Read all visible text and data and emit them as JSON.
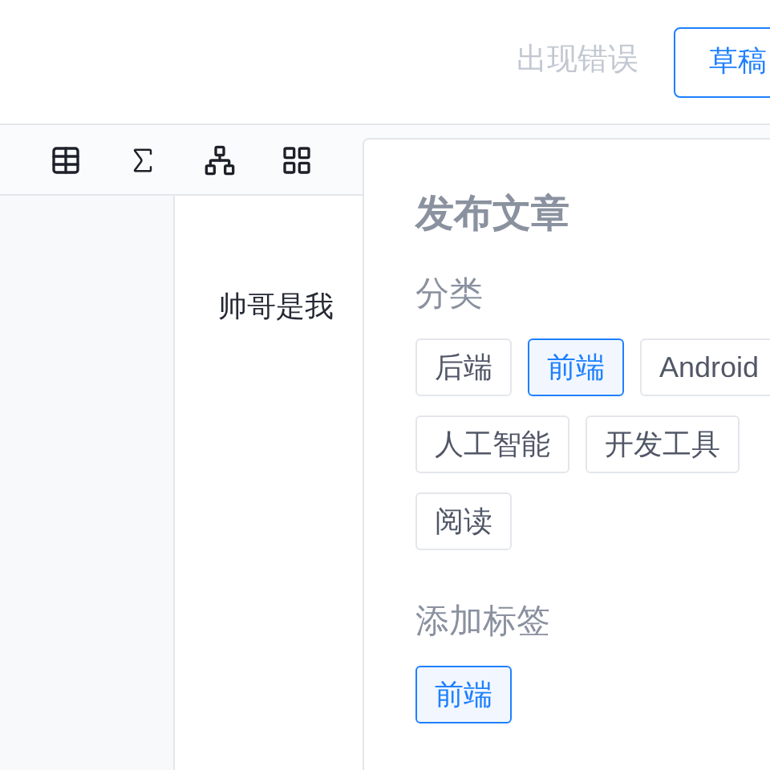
{
  "header": {
    "status": "出现错误",
    "draft_button": "草稿"
  },
  "editor": {
    "text": "帅哥是我"
  },
  "publish_panel": {
    "title": "发布文章",
    "category_label": "分类",
    "category_rows": [
      [
        {
          "label": "后端",
          "selected": false
        },
        {
          "label": "前端",
          "selected": true
        },
        {
          "label": "Android",
          "selected": false
        }
      ],
      [
        {
          "label": "人工智能",
          "selected": false
        },
        {
          "label": "开发工具",
          "selected": false
        }
      ],
      [
        {
          "label": "阅读",
          "selected": false
        }
      ]
    ],
    "tags_label": "添加标签",
    "tags": [
      {
        "label": "前端",
        "selected": true
      }
    ]
  }
}
